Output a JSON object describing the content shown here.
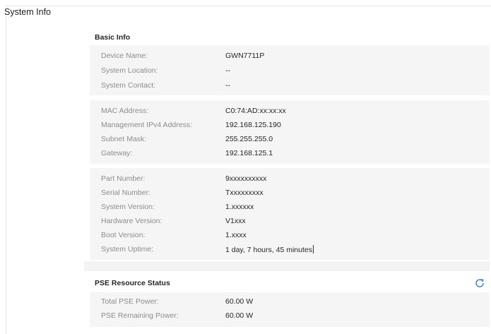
{
  "page": {
    "title": "System Info"
  },
  "basic_info": {
    "title": "Basic Info",
    "edit_icon": "edit-icon",
    "groups": [
      [
        {
          "label": "Device Name:",
          "value": "GWN7711P"
        },
        {
          "label": "System Location:",
          "value": "--"
        },
        {
          "label": "System Contact:",
          "value": "--"
        }
      ],
      [
        {
          "label": "MAC Address:",
          "value": "C0:74:AD:xx:xx:xx"
        },
        {
          "label": "Management IPv4 Address:",
          "value": "192.168.125.190"
        },
        {
          "label": "Subnet Mask:",
          "value": "255.255.255.0"
        },
        {
          "label": "Gateway:",
          "value": "192.168.125.1"
        }
      ],
      [
        {
          "label": "Part Number:",
          "value": "9xxxxxxxxxx"
        },
        {
          "label": "Serial Number:",
          "value": "Txxxxxxxxx"
        },
        {
          "label": "System Version:",
          "value": "1.xxxxxx"
        },
        {
          "label": "Hardware Version:",
          "value": "V1xxx"
        },
        {
          "label": "Boot Version:",
          "value": "1.xxxx"
        },
        {
          "label": "System Uptime:",
          "value": "1 day, 7 hours, 45 minutes"
        }
      ]
    ]
  },
  "pse": {
    "title": "PSE Resource Status",
    "refresh_icon": "refresh-icon",
    "rows": [
      {
        "label": "Total PSE Power:",
        "value": "60.00 W"
      },
      {
        "label": "PSE Remaining Power:",
        "value": "60.00 W"
      }
    ]
  },
  "colors": {
    "accent": "#2f80c7",
    "panel_bg": "#f5f5f5",
    "page_bg": "#f3f3f3"
  }
}
